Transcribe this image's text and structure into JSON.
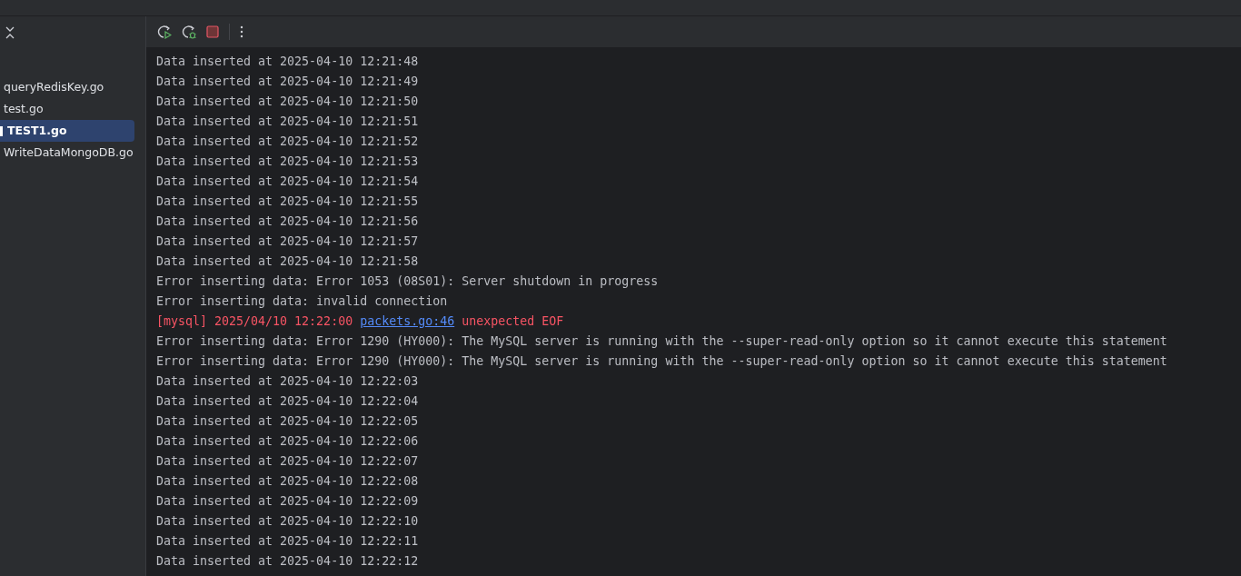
{
  "sidebar": {
    "items": [
      {
        "label": "queryRedisKey.go",
        "selected": false
      },
      {
        "label": "test.go",
        "selected": false
      },
      {
        "label": "TEST1.go",
        "selected": true
      },
      {
        "label": "WriteDataMongoDB.go",
        "selected": false
      }
    ]
  },
  "console": {
    "lines": [
      {
        "kind": "plain",
        "text": "Data inserted at 2025-04-10 12:21:48"
      },
      {
        "kind": "plain",
        "text": "Data inserted at 2025-04-10 12:21:49"
      },
      {
        "kind": "plain",
        "text": "Data inserted at 2025-04-10 12:21:50"
      },
      {
        "kind": "plain",
        "text": "Data inserted at 2025-04-10 12:21:51"
      },
      {
        "kind": "plain",
        "text": "Data inserted at 2025-04-10 12:21:52"
      },
      {
        "kind": "plain",
        "text": "Data inserted at 2025-04-10 12:21:53"
      },
      {
        "kind": "plain",
        "text": "Data inserted at 2025-04-10 12:21:54"
      },
      {
        "kind": "plain",
        "text": "Data inserted at 2025-04-10 12:21:55"
      },
      {
        "kind": "plain",
        "text": "Data inserted at 2025-04-10 12:21:56"
      },
      {
        "kind": "plain",
        "text": "Data inserted at 2025-04-10 12:21:57"
      },
      {
        "kind": "plain",
        "text": "Data inserted at 2025-04-10 12:21:58"
      },
      {
        "kind": "plain",
        "text": "Error inserting data: Error 1053 (08S01): Server shutdown in progress"
      },
      {
        "kind": "plain",
        "text": "Error inserting data: invalid connection"
      },
      {
        "kind": "log",
        "prefix": "[mysql] 2025/04/10 12:22:00",
        "link": "packets.go:46",
        "message": "unexpected EOF"
      },
      {
        "kind": "plain",
        "text": "Error inserting data: Error 1290 (HY000): The MySQL server is running with the --super-read-only option so it cannot execute this statement"
      },
      {
        "kind": "plain",
        "text": "Error inserting data: Error 1290 (HY000): The MySQL server is running with the --super-read-only option so it cannot execute this statement"
      },
      {
        "kind": "plain",
        "text": "Data inserted at 2025-04-10 12:22:03"
      },
      {
        "kind": "plain",
        "text": "Data inserted at 2025-04-10 12:22:04"
      },
      {
        "kind": "plain",
        "text": "Data inserted at 2025-04-10 12:22:05"
      },
      {
        "kind": "plain",
        "text": "Data inserted at 2025-04-10 12:22:06"
      },
      {
        "kind": "plain",
        "text": "Data inserted at 2025-04-10 12:22:07"
      },
      {
        "kind": "plain",
        "text": "Data inserted at 2025-04-10 12:22:08"
      },
      {
        "kind": "plain",
        "text": "Data inserted at 2025-04-10 12:22:09"
      },
      {
        "kind": "plain",
        "text": "Data inserted at 2025-04-10 12:22:10"
      },
      {
        "kind": "plain",
        "text": "Data inserted at 2025-04-10 12:22:11"
      },
      {
        "kind": "plain",
        "text": "Data inserted at 2025-04-10 12:22:12"
      }
    ]
  }
}
